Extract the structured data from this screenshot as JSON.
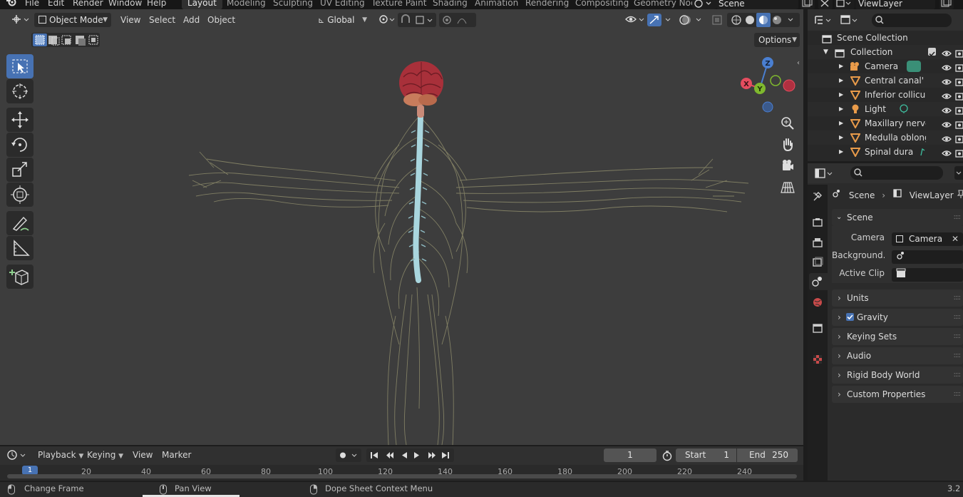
{
  "menu": {
    "file": "File",
    "edit": "Edit",
    "render": "Render",
    "window": "Window",
    "help": "Help"
  },
  "workspaces": [
    "Layout",
    "Modeling",
    "Sculpting",
    "UV Editing",
    "Texture Paint",
    "Shading",
    "Animation",
    "Rendering",
    "Compositing",
    "Geometry Noc"
  ],
  "scene_name": "Scene",
  "viewlayer_name": "ViewLayer",
  "viewport": {
    "mode": "Object Mode",
    "menus": {
      "view": "View",
      "select": "Select",
      "add": "Add",
      "object": "Object"
    },
    "transform_orientation": "Global",
    "options": "Options",
    "gizmo": {
      "z": "Z",
      "y": "Y",
      "x": "X"
    }
  },
  "outliner": {
    "scene_collection": "Scene Collection",
    "collection": "Collection",
    "items": [
      {
        "label": "Camera",
        "icon": "camera-object-icon"
      },
      {
        "label": "Central canal'",
        "icon": "mesh-icon"
      },
      {
        "label": "Inferior colliculus",
        "icon": "mesh-icon"
      },
      {
        "label": "Light",
        "icon": "light-icon"
      },
      {
        "label": "Maxillary nerve.l",
        "icon": "mesh-icon"
      },
      {
        "label": "Medulla oblongat",
        "icon": "mesh-icon"
      },
      {
        "label": "Spinal dura",
        "icon": "mesh-icon"
      }
    ]
  },
  "properties": {
    "breadcrumb_scene": "Scene",
    "breadcrumb_viewlayer": "ViewLayer",
    "panel_scene": "Scene",
    "camera_label": "Camera",
    "camera_value": "Camera",
    "background_label": "Background...",
    "active_clip_label": "Active Clip",
    "panels": [
      "Units",
      "Gravity",
      "Keying Sets",
      "Audio",
      "Rigid Body World",
      "Custom Properties"
    ]
  },
  "timeline": {
    "playback": "Playback",
    "keying": "Keying",
    "view": "View",
    "marker": "Marker",
    "current_frame": "1",
    "start_label": "Start",
    "start_value": "1",
    "end_label": "End",
    "end_value": "250",
    "ruler": [
      "1",
      "20",
      "40",
      "60",
      "80",
      "100",
      "120",
      "140",
      "160",
      "180",
      "200",
      "220",
      "240"
    ]
  },
  "statusbar": {
    "left": "Change Frame",
    "middle": "Pan View",
    "right": "Dope Sheet Context Menu",
    "version": "3.2"
  },
  "colors": {
    "accent": "#4772b3",
    "viewport_bg": "#3d3d3d",
    "brain": "#a8303a",
    "spinal_cord": "#a9d6de",
    "nerves": "#8c8a6a"
  }
}
